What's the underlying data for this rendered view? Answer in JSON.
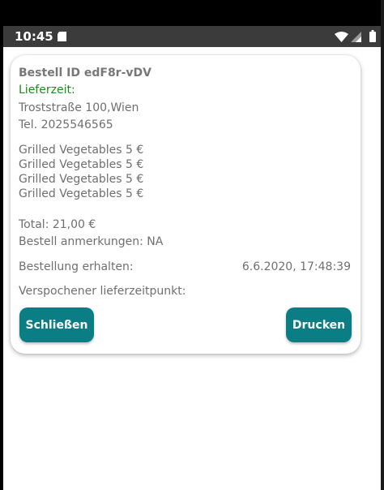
{
  "status_bar": {
    "time": "10:45",
    "icons": [
      "sd-card-icon",
      "wifi-icon",
      "signal-icon",
      "battery-icon"
    ]
  },
  "order": {
    "id_label": "Bestell ID edF8r-vDV",
    "delivery_label": "Lieferzeit:",
    "address": "Troststraße 100,Wien",
    "phone": "Tel. 2025546565",
    "items": [
      "Grilled Vegetables 5 €",
      "Grilled Vegetables 5 €",
      "Grilled Vegetables 5 €",
      "Grilled Vegetables 5 €"
    ],
    "total": "Total: 21,00 €",
    "notes": "Bestell anmerkungen: NA",
    "received_label": "Bestellung erhalten:",
    "received_value": "6.6.2020, 17:48:39",
    "promised_label": "Verspochener lieferzeitpunkt:"
  },
  "buttons": {
    "close_label": "Schließen",
    "print_label": "Drucken"
  },
  "colors": {
    "accent": "#0b7d85",
    "delivery_text": "#1f8a1f",
    "status_bar": "#3b3b3b"
  }
}
